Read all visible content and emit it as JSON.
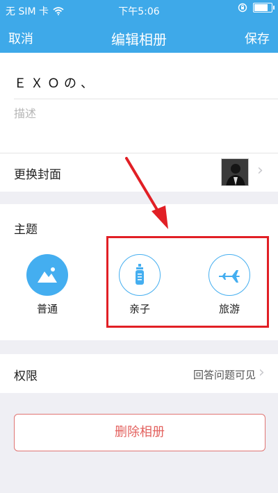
{
  "status": {
    "carrier": "无 SIM 卡",
    "time": "下午5:06",
    "battery_level": 0.85
  },
  "nav": {
    "cancel": "取消",
    "title": "编辑相册",
    "save": "保存"
  },
  "album": {
    "name": "ＥＸＯの、",
    "description_placeholder": "描述"
  },
  "cover": {
    "label": "更换封面"
  },
  "theme": {
    "label": "主题",
    "options": [
      {
        "name": "普通",
        "icon": "mountain-image-icon",
        "selected": true
      },
      {
        "name": "亲子",
        "icon": "baby-bottle-icon",
        "selected": false
      },
      {
        "name": "旅游",
        "icon": "airplane-icon",
        "selected": false
      }
    ]
  },
  "permission": {
    "label": "权限",
    "value": "回答问题可见"
  },
  "delete_label": "删除相册",
  "colors": {
    "accent": "#3ea9e9",
    "annotation": "#e11f25",
    "danger": "#e3625f"
  }
}
